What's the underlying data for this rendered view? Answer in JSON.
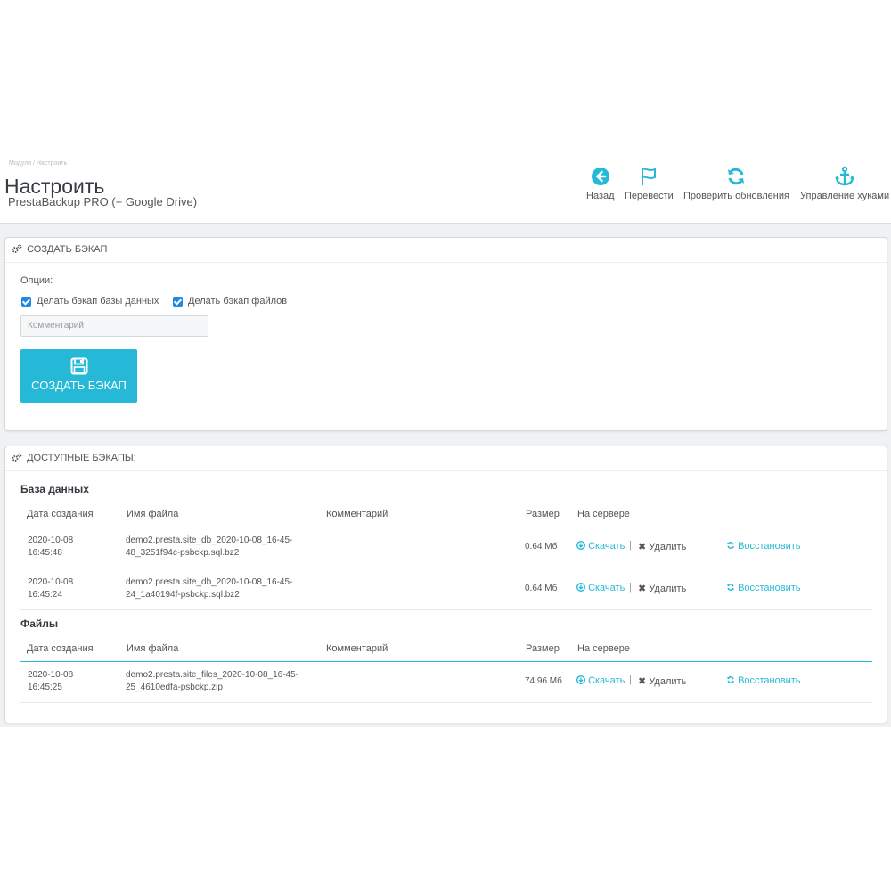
{
  "header": {
    "breadcrumb": "Модули  /  Настроить",
    "title": "Настроить",
    "subtitle": "PrestaBackup PRO (+ Google Drive)",
    "toolbar": [
      {
        "label": "Назад",
        "icon": "arrow-left-circle-icon"
      },
      {
        "label": "Перевести",
        "icon": "flag-icon"
      },
      {
        "label": "Проверить обновления",
        "icon": "refresh-icon"
      },
      {
        "label": "Управление хуками",
        "icon": "anchor-icon"
      }
    ]
  },
  "create_panel": {
    "title": "СОЗДАТЬ БЭКАП",
    "options_label": "Опции:",
    "checkbox_db": "Делать бэкап базы данных",
    "checkbox_files": "Делать бэкап файлов",
    "comment_placeholder": "Комментарий",
    "button_label": "СОЗДАТЬ БЭКАП"
  },
  "backups_panel": {
    "title": "ДОСТУПНЫЕ БЭКАПЫ:",
    "columns": [
      "Дата создания",
      "Имя файла",
      "Комментарий",
      "Размер",
      "На сервере"
    ],
    "download_label": "Скачать",
    "delete_label": "Удалить",
    "restore_label": "Восстановить",
    "database": {
      "title": "База данных",
      "rows": [
        {
          "date": "2020-10-08",
          "time": "16:45:48",
          "file1": "demo2.presta.site_db_2020-10-08_16-45-",
          "file2": "48_3251f94c-psbckp.sql.bz2",
          "comment": "",
          "size": "0.64 Мб"
        },
        {
          "date": "2020-10-08",
          "time": "16:45:24",
          "file1": "demo2.presta.site_db_2020-10-08_16-45-",
          "file2": "24_1a40194f-psbckp.sql.bz2",
          "comment": "",
          "size": "0.64 Мб"
        }
      ]
    },
    "files": {
      "title": "Файлы",
      "rows": [
        {
          "date": "2020-10-08",
          "time": "16:45:25",
          "file1": "demo2.presta.site_files_2020-10-08_16-45-",
          "file2": "25_4610edfa-psbckp.zip",
          "comment": "",
          "size": "74.96 Мб"
        }
      ]
    }
  },
  "colors": {
    "accent": "#25b9d7",
    "checkbox": "#1e88e5",
    "background": "#eff1f2"
  }
}
